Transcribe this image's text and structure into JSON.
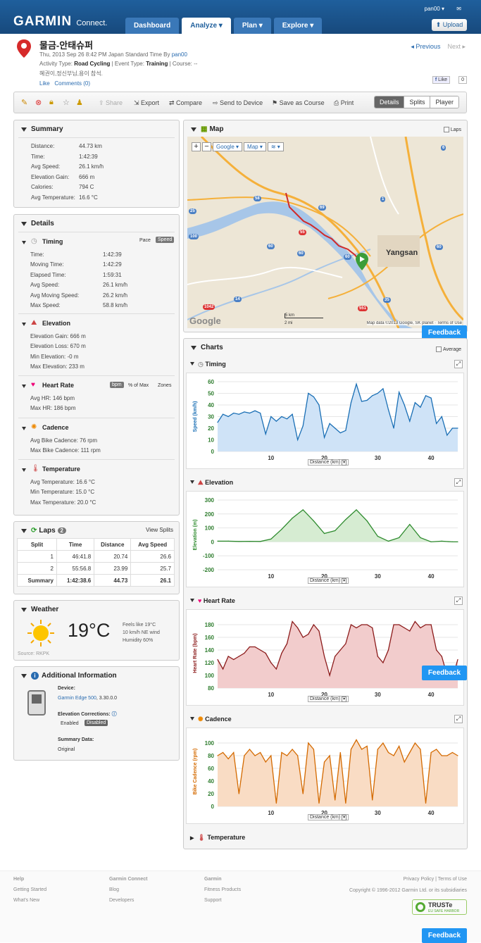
{
  "header": {
    "logo": "GARMIN",
    "logo_sub": "Connect.",
    "user": "pan00 ▾",
    "upload": "Upload",
    "nav": [
      "Dashboard",
      "Analyze ▾",
      "Plan ▾",
      "Explore ▾"
    ]
  },
  "activity": {
    "title": "물금-안태슈퍼",
    "datetime": "Thu, 2013 Sep 26 8:42 PM Japan Standard Time By",
    "by": "pan00",
    "type_line_prefix": "Activity Type:",
    "activity_type": "Road Cycling",
    "event_label": "| Event Type:",
    "event_type": "Training",
    "course_label": "| Course: --",
    "desc": "혜권이,정신부님,용이 참석.",
    "like": "Like",
    "comments": "Comments (0)",
    "previous": "Previous",
    "next": "Next",
    "fb_like": "Like",
    "fb_count": "0"
  },
  "toolbar": {
    "share": "Share",
    "export": "Export",
    "compare": "Compare",
    "send": "Send to Device",
    "save_course": "Save as Course",
    "print": "Print",
    "views": [
      "Details",
      "Splits",
      "Player"
    ]
  },
  "summary": {
    "title": "Summary",
    "rows": [
      {
        "label": "Distance:",
        "value": "44.73 km"
      },
      {
        "label": "Time:",
        "value": "1:42:39"
      },
      {
        "label": "Avg Speed:",
        "value": "26.1 km/h"
      },
      {
        "label": "Elevation Gain:",
        "value": "666 m"
      },
      {
        "label": "Calories:",
        "value": "794 C"
      },
      {
        "label": "Avg Temperature:",
        "value": "16.6 °C"
      }
    ]
  },
  "details": {
    "title": "Details",
    "timing": {
      "title": "Timing",
      "pace": "Pace",
      "speed": "Speed",
      "rows": [
        {
          "label": "Time:",
          "value": "1:42:39"
        },
        {
          "label": "Moving Time:",
          "value": "1:42:29"
        },
        {
          "label": "Elapsed Time:",
          "value": "1:59:31"
        },
        {
          "label": "Avg Speed:",
          "value": "26.1 km/h"
        },
        {
          "label": "Avg Moving Speed:",
          "value": "26.2 km/h"
        },
        {
          "label": "Max Speed:",
          "value": "58.8 km/h"
        }
      ]
    },
    "elevation": {
      "title": "Elevation",
      "rows": [
        {
          "label": "Elevation Gain:",
          "value": "666 m"
        },
        {
          "label": "Elevation Loss:",
          "value": "670 m"
        },
        {
          "label": "Min Elevation:",
          "value": "-0 m"
        },
        {
          "label": "Max Elevation:",
          "value": "233 m"
        }
      ]
    },
    "heart": {
      "title": "Heart Rate",
      "bpm": "bpm",
      "pct": "% of Max",
      "zones": "Zones",
      "rows": [
        {
          "label": "Avg HR:",
          "value": "146 bpm"
        },
        {
          "label": "Max HR:",
          "value": "186 bpm"
        }
      ]
    },
    "cadence": {
      "title": "Cadence",
      "rows": [
        {
          "label": "Avg Bike Cadence:",
          "value": "76 rpm"
        },
        {
          "label": "Max Bike Cadence:",
          "value": "111 rpm"
        }
      ]
    },
    "temperature": {
      "title": "Temperature",
      "rows": [
        {
          "label": "Avg Temperature:",
          "value": "16.6 °C"
        },
        {
          "label": "Min Temperature:",
          "value": "15.0 °C"
        },
        {
          "label": "Max Temperature:",
          "value": "20.0 °C"
        }
      ]
    }
  },
  "laps": {
    "title": "Laps",
    "count": "2",
    "view_splits": "View Splits",
    "headers": [
      "Split",
      "Time",
      "Distance",
      "Avg Speed"
    ],
    "rows": [
      [
        "1",
        "46:41.8",
        "20.74",
        "26.6"
      ],
      [
        "2",
        "55:56.8",
        "23.99",
        "25.7"
      ],
      [
        "Summary",
        "1:42:38.6",
        "44.73",
        "26.1"
      ]
    ]
  },
  "weather": {
    "title": "Weather",
    "temp": "19°C",
    "feels": "Feels like 19°C",
    "wind": "10 km/h NE wind",
    "humidity": "Humidity 60%",
    "source": "Source: RKPK"
  },
  "additional": {
    "title": "Additional Information",
    "device_label": "Device:",
    "device": "Garmin Edge 500",
    "device_ver": ", 3.30.0.0",
    "elev_corr": "Elevation Corrections",
    "enabled": "Enabled",
    "disabled": "Disabled",
    "summary_label": "Summary Data:",
    "summary_val": "Original"
  },
  "map": {
    "title": "Map",
    "laps": "Laps",
    "google": "Google ▾",
    "map_btn": "Map ▾",
    "credit": "Map data ©2013 Google, SK planet · Terms of Use",
    "city": "Yangsan",
    "scale_km": "5 km",
    "scale_mi": "2 mi",
    "road1": "Gyeongbu Expy",
    "road2": "Gyeongbu Expy",
    "shields": [
      "58",
      "69",
      "55",
      "60",
      "60",
      "60",
      "6",
      "35",
      "60",
      "14",
      "1042",
      "551",
      "1",
      "100",
      "25"
    ]
  },
  "charts": {
    "title": "Charts",
    "average": "Average",
    "feedback": "Feedback",
    "dist_label": "Distance (km)",
    "temperature_title": "Temperature"
  },
  "chart_data": [
    {
      "type": "area",
      "title": "Timing",
      "ylabel": "Speed (km/h)",
      "xlabel": "Distance (km)",
      "color": "#1a6fb5",
      "fill": "#cfe3f7",
      "ylim": [
        0,
        60
      ],
      "yticks": [
        0,
        10,
        20,
        30,
        40,
        50,
        60
      ],
      "xlim": [
        0,
        45
      ],
      "xticks": [
        10,
        20,
        30,
        40
      ],
      "x": [
        0,
        1,
        2,
        3,
        4,
        5,
        6,
        7,
        8,
        9,
        10,
        11,
        12,
        13,
        14,
        15,
        16,
        17,
        18,
        19,
        20,
        21,
        22,
        23,
        24,
        25,
        26,
        27,
        28,
        29,
        30,
        31,
        32,
        33,
        34,
        35,
        36,
        37,
        38,
        39,
        40,
        41,
        42,
        43,
        44,
        45
      ],
      "y": [
        25,
        32,
        30,
        33,
        32,
        34,
        33,
        35,
        33,
        15,
        30,
        26,
        30,
        28,
        32,
        10,
        22,
        50,
        47,
        40,
        12,
        24,
        20,
        16,
        18,
        42,
        58,
        43,
        44,
        48,
        50,
        54,
        36,
        20,
        51,
        40,
        26,
        42,
        38,
        48,
        46,
        24,
        30,
        14,
        20,
        20
      ]
    },
    {
      "type": "area",
      "title": "Elevation",
      "ylabel": "Elevation (m)",
      "xlabel": "Distance (km)",
      "color": "#2e8b2e",
      "fill": "#d6ecd2",
      "ylim": [
        -200,
        300
      ],
      "yticks": [
        -200,
        -100,
        0,
        100,
        200,
        300
      ],
      "xlim": [
        0,
        45
      ],
      "xticks": [
        10,
        20,
        30,
        40
      ],
      "x": [
        0,
        2,
        4,
        6,
        8,
        10,
        12,
        14,
        16,
        18,
        20,
        22,
        24,
        26,
        28,
        30,
        32,
        34,
        36,
        38,
        40,
        42,
        44,
        45
      ],
      "y": [
        5,
        5,
        3,
        4,
        3,
        20,
        90,
        170,
        230,
        150,
        60,
        80,
        160,
        230,
        150,
        40,
        5,
        30,
        125,
        30,
        0,
        5,
        0,
        0
      ]
    },
    {
      "type": "area",
      "title": "Heart Rate",
      "ylabel": "Heart Rate (bpm)",
      "xlabel": "Distance (km)",
      "color": "#8b1a1a",
      "fill": "#f2cccc",
      "ylim": [
        80,
        190
      ],
      "yticks": [
        80,
        100,
        120,
        140,
        160,
        180
      ],
      "xlim": [
        0,
        45
      ],
      "xticks": [
        10,
        20,
        30,
        40
      ],
      "x": [
        0,
        1,
        2,
        3,
        4,
        5,
        6,
        7,
        8,
        9,
        10,
        11,
        12,
        13,
        14,
        15,
        16,
        17,
        18,
        19,
        20,
        21,
        22,
        23,
        24,
        25,
        26,
        27,
        28,
        29,
        30,
        31,
        32,
        33,
        34,
        35,
        36,
        37,
        38,
        39,
        40,
        41,
        42,
        43,
        44,
        45
      ],
      "y": [
        125,
        110,
        130,
        125,
        130,
        135,
        145,
        145,
        140,
        135,
        120,
        110,
        135,
        150,
        185,
        175,
        160,
        165,
        180,
        170,
        130,
        100,
        130,
        140,
        150,
        180,
        175,
        180,
        180,
        175,
        130,
        120,
        140,
        180,
        180,
        175,
        170,
        185,
        175,
        180,
        180,
        140,
        130,
        100,
        95,
        125
      ]
    },
    {
      "type": "area",
      "title": "Cadence",
      "ylabel": "Bike Cadence (rpm)",
      "xlabel": "Distance (km)",
      "color": "#d46a00",
      "fill": "#f9dcc4",
      "ylim": [
        0,
        110
      ],
      "yticks": [
        0,
        20,
        40,
        60,
        80,
        100
      ],
      "xlim": [
        0,
        45
      ],
      "xticks": [
        10,
        20,
        30,
        40
      ],
      "x": [
        0,
        1,
        2,
        3,
        4,
        5,
        6,
        7,
        8,
        9,
        10,
        11,
        12,
        13,
        14,
        15,
        16,
        17,
        18,
        19,
        20,
        21,
        22,
        23,
        24,
        25,
        26,
        27,
        28,
        29,
        30,
        31,
        32,
        33,
        34,
        35,
        36,
        37,
        38,
        39,
        40,
        41,
        42,
        43,
        44,
        45
      ],
      "y": [
        80,
        85,
        75,
        85,
        20,
        80,
        90,
        80,
        85,
        70,
        80,
        5,
        85,
        80,
        90,
        80,
        20,
        100,
        90,
        5,
        70,
        80,
        10,
        85,
        5,
        90,
        105,
        90,
        95,
        10,
        90,
        100,
        85,
        80,
        95,
        70,
        85,
        100,
        90,
        5,
        85,
        90,
        80,
        80,
        85,
        80
      ]
    }
  ],
  "footer": {
    "help": "Help",
    "getting_started": "Getting Started",
    "whats_new": "What's New",
    "gc": "Garmin Connect",
    "blog": "Blog",
    "developers": "Developers",
    "garmin": "Garmin",
    "fitness": "Fitness Products",
    "support": "Support",
    "privacy": "Privacy Policy | Terms of Use",
    "copyright": "Copyright © 1996-2012 Garmin Ltd. or its subsidiaries",
    "truste": "TRUSTe",
    "truste_sub": "EU SAFE HARBOR"
  }
}
